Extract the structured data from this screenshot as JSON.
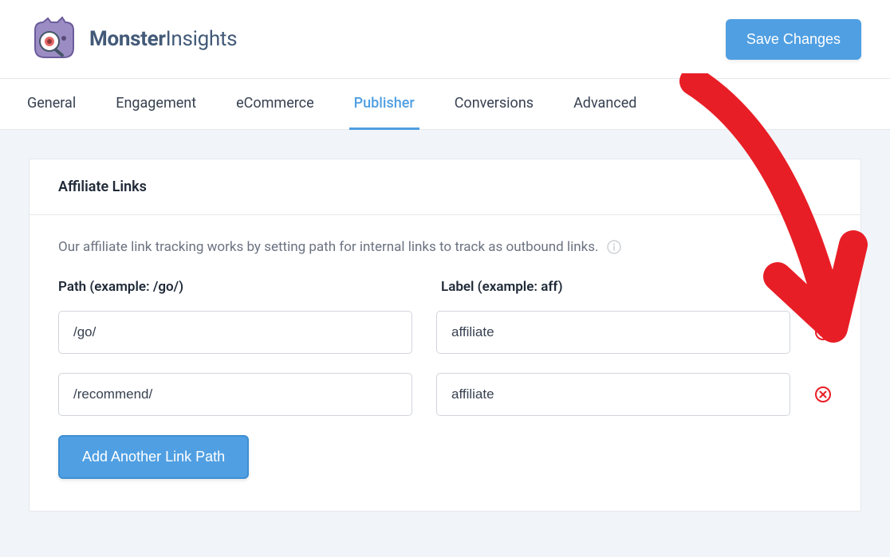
{
  "brand": {
    "name_bold": "Monster",
    "name_light": "Insights"
  },
  "header": {
    "save_button": "Save Changes"
  },
  "tabs": [
    {
      "label": "General",
      "active": false
    },
    {
      "label": "Engagement",
      "active": false
    },
    {
      "label": "eCommerce",
      "active": false
    },
    {
      "label": "Publisher",
      "active": true
    },
    {
      "label": "Conversions",
      "active": false
    },
    {
      "label": "Advanced",
      "active": false
    }
  ],
  "card": {
    "title": "Affiliate Links",
    "description": "Our affiliate link tracking works by setting path for internal links to track as outbound links.",
    "path_label": "Path (example: /go/)",
    "label_label": "Label (example: aff)",
    "rows": [
      {
        "path": "/go/",
        "label": "affiliate"
      },
      {
        "path": "/recommend/",
        "label": "affiliate"
      }
    ],
    "add_button": "Add Another Link Path"
  },
  "colors": {
    "accent": "#509fe2",
    "danger": "#e81e26"
  }
}
